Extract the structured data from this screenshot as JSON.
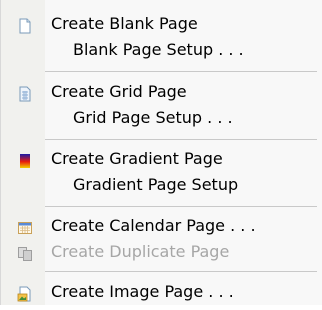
{
  "menu": {
    "items": [
      {
        "label": "Create Blank Page",
        "icon": "blank-page-icon",
        "enabled": true
      },
      {
        "label": "Blank Page Setup . . .",
        "sub": true,
        "enabled": true
      },
      {
        "label": "Create Grid Page",
        "icon": "grid-page-icon",
        "enabled": true
      },
      {
        "label": "Grid Page Setup . . .",
        "sub": true,
        "enabled": true
      },
      {
        "label": "Create Gradient Page",
        "icon": "gradient-page-icon",
        "enabled": true
      },
      {
        "label": "Gradient Page Setup",
        "sub": true,
        "enabled": true
      },
      {
        "label": "Create Calendar Page . . .",
        "icon": "calendar-page-icon",
        "enabled": true
      },
      {
        "label": "Create Duplicate Page",
        "icon": "duplicate-page-icon",
        "enabled": false
      },
      {
        "label": "Create Image Page . . .",
        "icon": "image-page-icon",
        "enabled": true
      }
    ]
  }
}
